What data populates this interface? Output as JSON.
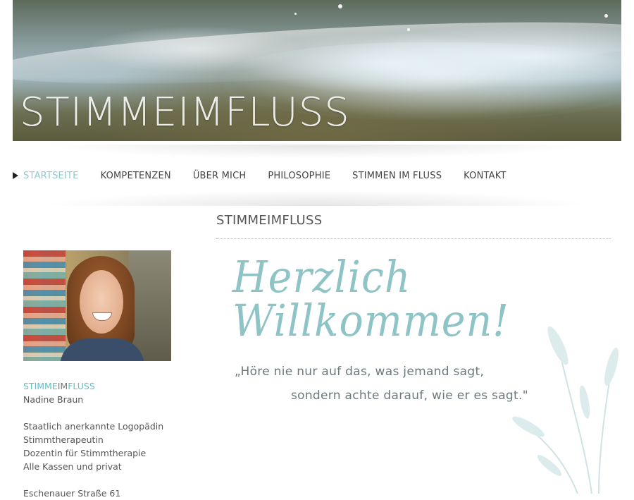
{
  "header": {
    "site_title": "STIMMEIMFLUSS"
  },
  "nav": {
    "items": [
      {
        "label": "STARTSEITE",
        "active": true
      },
      {
        "label": "KOMPETENZEN",
        "active": false
      },
      {
        "label": "ÜBER MICH",
        "active": false
      },
      {
        "label": "PHILOSOPHIE",
        "active": false
      },
      {
        "label": "STIMMEN IM FLUSS",
        "active": false
      },
      {
        "label": "KONTAKT",
        "active": false
      }
    ]
  },
  "main": {
    "section_title": "STIMMEIMFLUSS",
    "welcome": "Herzlich Willkommen!",
    "quote_line1": "„Höre nie nur auf das, was jemand sagt,",
    "quote_line2": "sondern achte darauf, wie er es sagt.\""
  },
  "sidebar": {
    "brand_part1": "STIMME",
    "brand_part2": "IM",
    "brand_part3": "FLUSS",
    "name": "Nadine Braun",
    "qualifications": [
      "Staatlich anerkannte Logopädin",
      "Stimmtherapeutin",
      "Dozentin für Stimmtherapie",
      "Alle Kassen und privat"
    ],
    "address_line1": "Eschenauer Straße 61"
  },
  "colors": {
    "accent": "#5dbfc9",
    "nav_active": "#8fc7cf",
    "welcome": "#8fc4c6"
  }
}
